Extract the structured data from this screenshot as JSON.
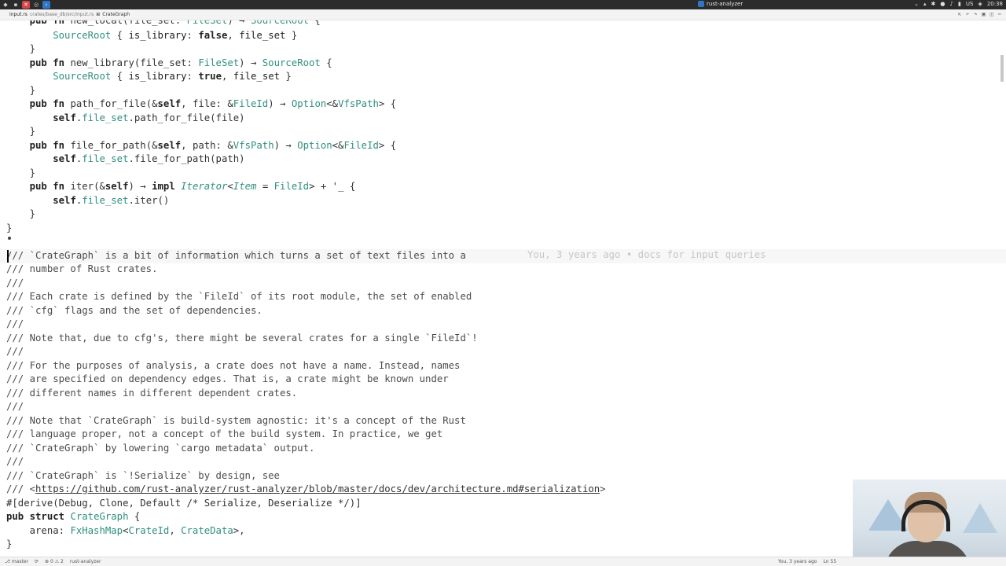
{
  "topbar": {
    "app_title": "rust-analyzer",
    "keyboard_layout": "US",
    "clock": "20:38"
  },
  "breadcrumb": {
    "tab": "input.rs",
    "path": "crates/base_db/src/input.rs",
    "symbol": "CrateGraph"
  },
  "editor": {
    "blame": "You, 3 years ago • docs for input queries",
    "url": "https://github.com/rust-analyzer/rust-analyzer/blob/master/docs/dev/architecture.md#serialization"
  },
  "status": {
    "branch": "master",
    "problems": "0",
    "warnings": "2",
    "server": "rust-analyzer",
    "blame_short": "You, 3 years ago",
    "position": "Ln 55"
  },
  "colors": {
    "type": "#2f8f7f",
    "comment": "#4c4c4c",
    "blame": "#c6c6c6"
  }
}
